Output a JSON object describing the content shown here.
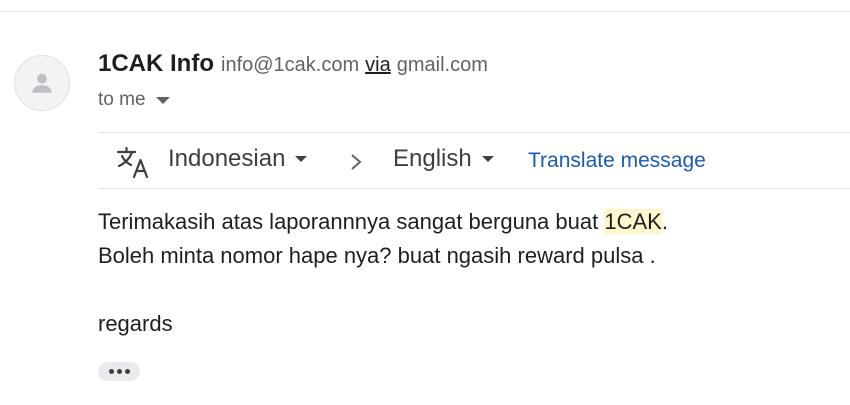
{
  "message": {
    "sender_name": "1CAK Info",
    "sender_email": "info@1cak.com",
    "via_label": "via",
    "via_domain": "gmail.com",
    "to_label": "to me"
  },
  "translate_bar": {
    "icon": "translate-icon",
    "from_language": "Indonesian",
    "to_language": "English",
    "action_label": "Translate message"
  },
  "body": {
    "line1_before": "Terimakasih atas laporannnya sangat berguna buat ",
    "line1_highlight": "1CAK",
    "line1_after": ".",
    "line2": "Boleh minta nomor hape nya? buat ngasih reward pulsa .",
    "line3": "regards",
    "highlight_color": "#fef6cd"
  },
  "colors": {
    "link": "#1a5cb5",
    "secondary_text": "#5f6368"
  }
}
